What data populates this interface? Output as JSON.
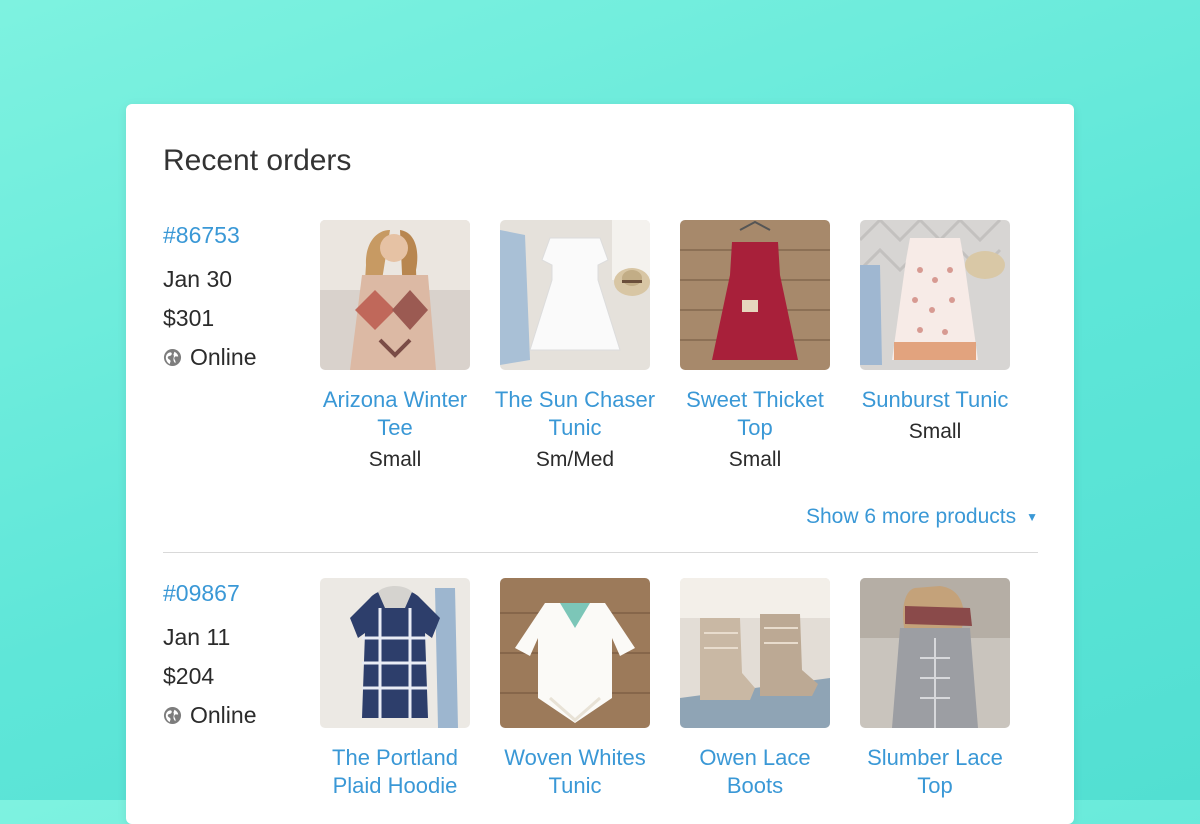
{
  "card": {
    "title": "Recent orders"
  },
  "orders": [
    {
      "id": "#86753",
      "date": "Jan 30",
      "total": "$301",
      "channel": "Online",
      "products": [
        {
          "name": "Arizona Winter Tee",
          "size": "Small"
        },
        {
          "name": "The Sun Chaser Tunic",
          "size": "Sm/Med"
        },
        {
          "name": "Sweet Thicket Top",
          "size": "Small"
        },
        {
          "name": "Sunburst Tunic",
          "size": "Small"
        }
      ],
      "show_more": "Show 6 more products"
    },
    {
      "id": "#09867",
      "date": "Jan 11",
      "total": "$204",
      "channel": "Online",
      "products": [
        {
          "name": "The Portland Plaid Hoodie"
        },
        {
          "name": "Woven Whites Tunic"
        },
        {
          "name": "Owen Lace Boots"
        },
        {
          "name": "Slumber Lace Top"
        }
      ]
    }
  ],
  "colors": {
    "accent": "#3a98d6",
    "text": "#2b2b2b",
    "background": "#6aebdc"
  }
}
